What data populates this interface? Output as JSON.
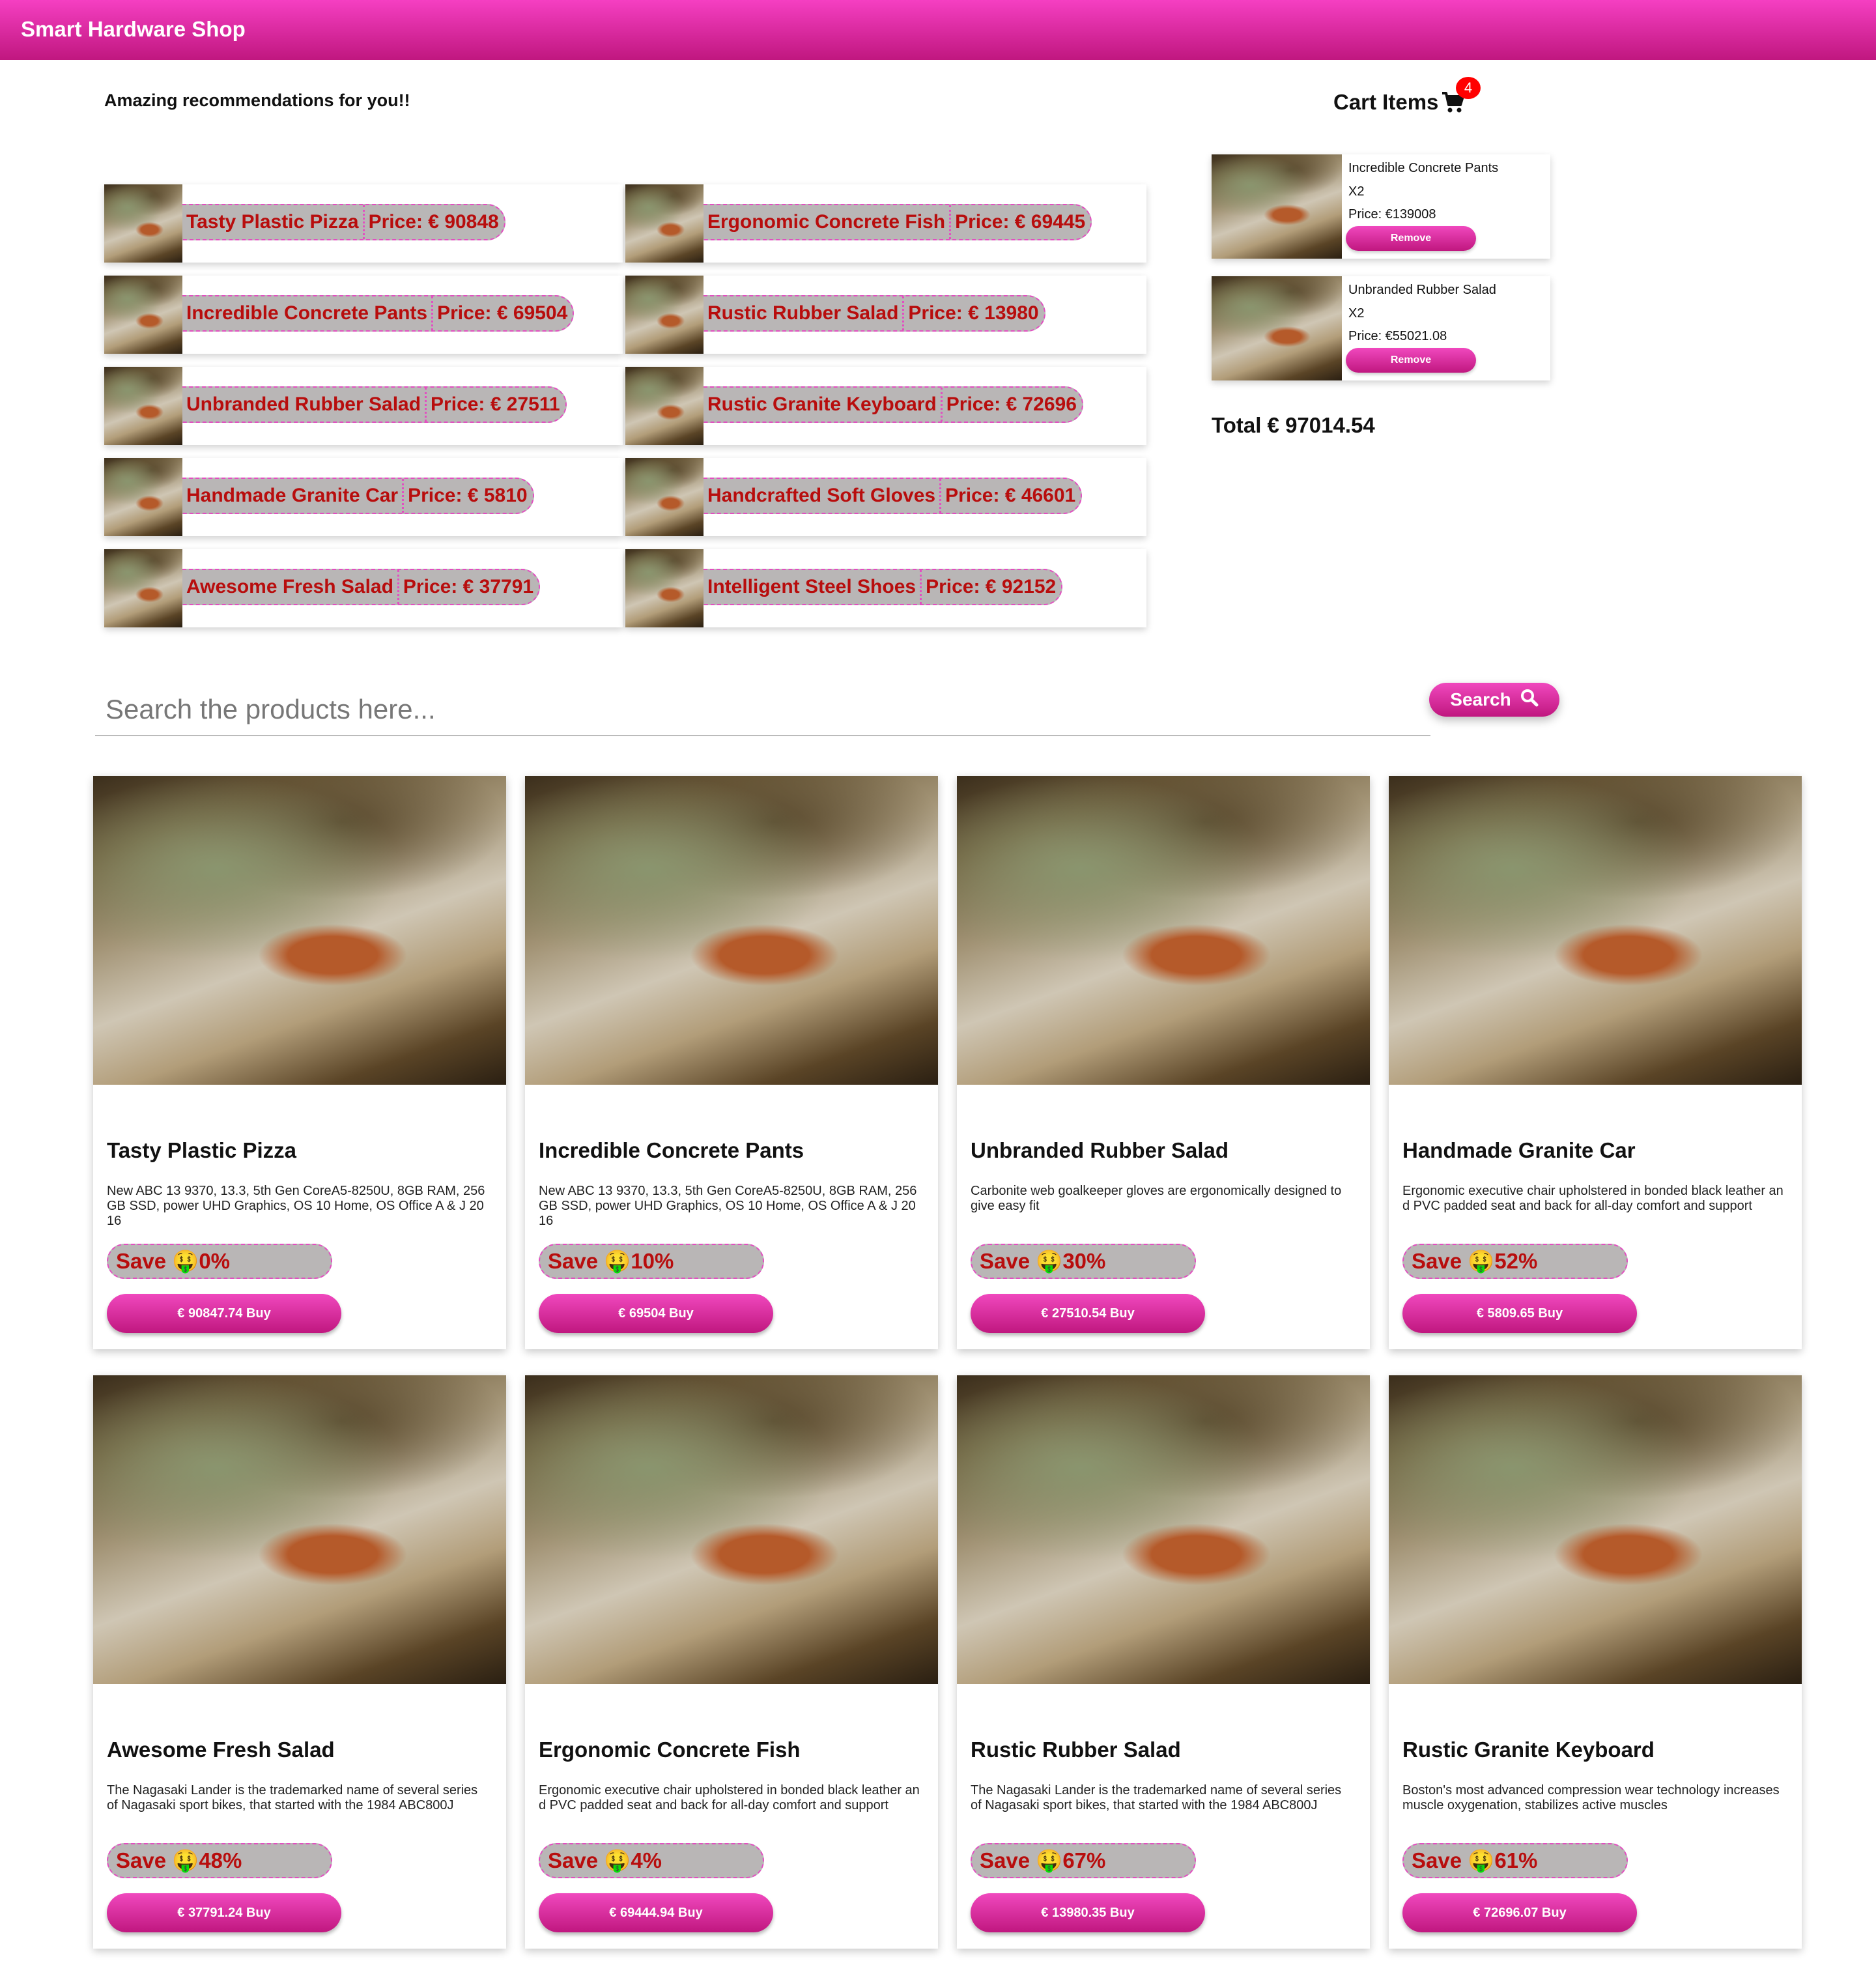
{
  "app": {
    "title": "Smart Hardware Shop"
  },
  "recommendations": {
    "heading": "Amazing recommendations for you!!",
    "price_prefix": "Price: € ",
    "items": [
      {
        "name": "Tasty Plastic Pizza",
        "price": "90848"
      },
      {
        "name": "Ergonomic Concrete Fish",
        "price": "69445"
      },
      {
        "name": "Incredible Concrete Pants",
        "price": "69504"
      },
      {
        "name": "Rustic Rubber Salad",
        "price": "13980"
      },
      {
        "name": "Unbranded Rubber Salad",
        "price": "27511"
      },
      {
        "name": "Rustic Granite Keyboard",
        "price": "72696"
      },
      {
        "name": "Handmade Granite Car",
        "price": "5810"
      },
      {
        "name": "Handcrafted Soft Gloves",
        "price": "46601"
      },
      {
        "name": "Awesome Fresh Salad",
        "price": "37791"
      },
      {
        "name": "Intelligent Steel Shoes",
        "price": "92152"
      }
    ]
  },
  "cart": {
    "heading": "Cart Items",
    "count": "4",
    "items": [
      {
        "name": "Incredible Concrete Pants",
        "qty": "X2",
        "price": "Price: €139008",
        "remove_label": "Remove"
      },
      {
        "name": "Unbranded Rubber Salad",
        "qty": "X2",
        "price": "Price: €55021.08",
        "remove_label": "Remove"
      }
    ],
    "total": "Total € 97014.54"
  },
  "search": {
    "placeholder": "Search the products here...",
    "value": "",
    "button_label": "Search"
  },
  "icons": {
    "cart": "shopping-cart-icon",
    "search": "magnifier-icon",
    "save": "money-mouth-face-emoji"
  },
  "colors": {
    "brand": "#e02aa8",
    "price_text": "#b80d0d",
    "pill_bg": "#b9b6b6",
    "badge": "#ff0000"
  },
  "products": [
    {
      "name": "Tasty Plastic Pizza",
      "description": "New ABC 13 9370, 13.3, 5th Gen CoreA5-8250U, 8GB RAM, 256GB SSD, power UHD Graphics, OS 10 Home, OS Office A & J 2016",
      "save": "Save 🤑0%",
      "buy": "€ 90847.74 Buy"
    },
    {
      "name": "Incredible Concrete Pants",
      "description": "New ABC 13 9370, 13.3, 5th Gen CoreA5-8250U, 8GB RAM, 256GB SSD, power UHD Graphics, OS 10 Home, OS Office A & J 2016",
      "save": "Save 🤑10%",
      "buy": "€ 69504 Buy"
    },
    {
      "name": "Unbranded Rubber Salad",
      "description": "Carbonite web goalkeeper gloves are ergonomically designed to give easy fit",
      "save": "Save 🤑30%",
      "buy": "€ 27510.54 Buy"
    },
    {
      "name": "Handmade Granite Car",
      "description": "Ergonomic executive chair upholstered in bonded black leather and PVC padded seat and back for all-day comfort and support",
      "save": "Save 🤑52%",
      "buy": "€ 5809.65 Buy"
    },
    {
      "name": "Awesome Fresh Salad",
      "description": "The Nagasaki Lander is the trademarked name of several series of Nagasaki sport bikes, that started with the 1984 ABC800J",
      "save": "Save 🤑48%",
      "buy": "€ 37791.24 Buy"
    },
    {
      "name": "Ergonomic Concrete Fish",
      "description": "Ergonomic executive chair upholstered in bonded black leather and PVC padded seat and back for all-day comfort and support",
      "save": "Save 🤑4%",
      "buy": "€ 69444.94 Buy"
    },
    {
      "name": "Rustic Rubber Salad",
      "description": "The Nagasaki Lander is the trademarked name of several series of Nagasaki sport bikes, that started with the 1984 ABC800J",
      "save": "Save 🤑67%",
      "buy": "€ 13980.35 Buy"
    },
    {
      "name": "Rustic Granite Keyboard",
      "description": "Boston's most advanced compression wear technology increases muscle oxygenation, stabilizes active muscles",
      "save": "Save 🤑61%",
      "buy": "€ 72696.07 Buy"
    }
  ]
}
